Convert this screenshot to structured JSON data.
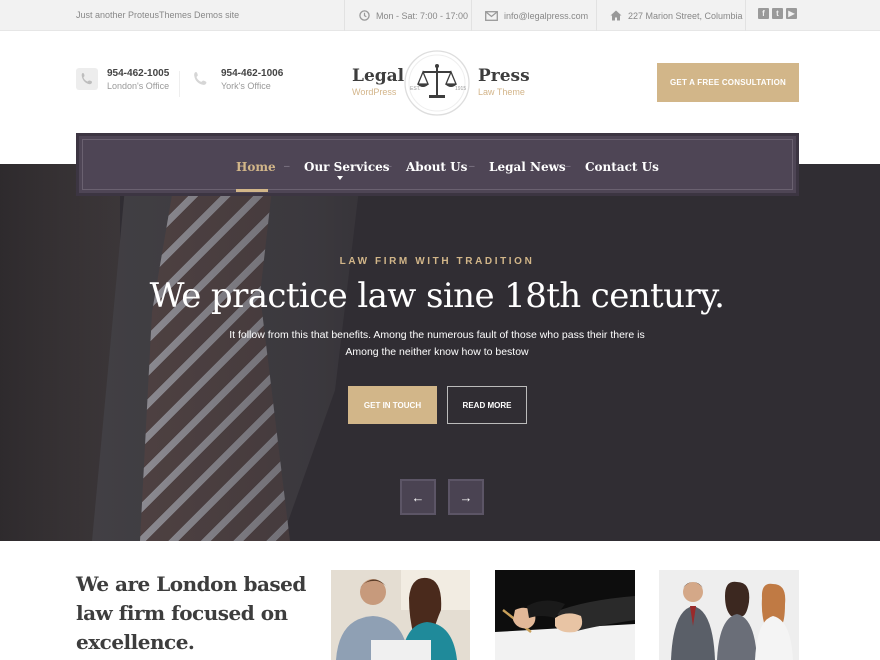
{
  "topbar": {
    "tagline": "Just another ProteusThemes Demos site",
    "hours": "Mon - Sat: 7:00 - 17:00",
    "email": "info@legalpress.com",
    "address": "227 Marion Street, Columbia",
    "social": [
      "facebook-icon",
      "twitter-icon",
      "youtube-icon"
    ]
  },
  "header": {
    "phones": [
      {
        "number": "954-462-1005",
        "label": "London's Office"
      },
      {
        "number": "954-462-1006",
        "label": "York's Office"
      }
    ],
    "logo": {
      "word_left": "Legal",
      "sub_left": "WordPress",
      "word_right": "Press",
      "sub_right": "Law Theme",
      "seal_left": "EST.",
      "seal_right": "1915"
    },
    "cta": "GET A FREE CONSULTATION"
  },
  "nav": {
    "items": [
      "Home",
      "Our Services",
      "About Us",
      "Legal News",
      "Contact Us"
    ],
    "active": "Home"
  },
  "hero": {
    "kicker": "LAW FIRM WITH TRADITION",
    "headline": "We practice law sine 18th century.",
    "text_line1": "It follow from this that benefits. Among the numerous fault of those who pass their there is",
    "text_line2": "Among the neither know how to bestow",
    "btn_primary": "GET IN TOUCH",
    "btn_secondary": "READ MORE",
    "prev": "←",
    "next": "→"
  },
  "about": {
    "line1": "We are London based",
    "line2": "law firm focused on",
    "line3": "excellence."
  },
  "colors": {
    "gold": "#d2b689",
    "nav_bg": "#4e4555",
    "hero_bg": "#302d33"
  }
}
